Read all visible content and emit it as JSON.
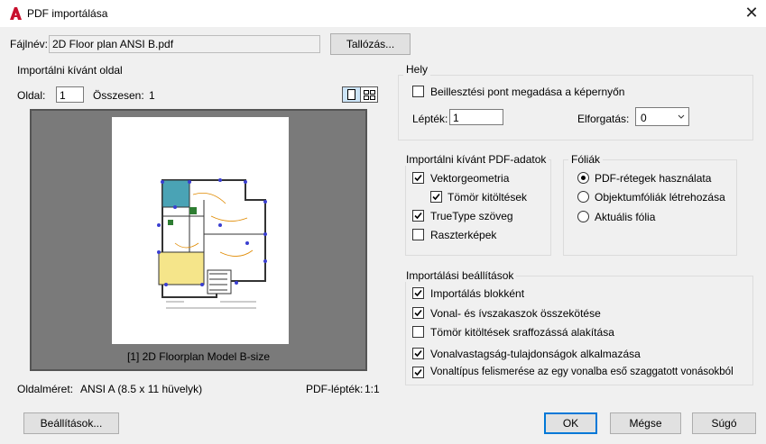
{
  "dialog": {
    "title": "PDF importálása",
    "close_glyph": "✕",
    "app_icon": "autocad-a-icon"
  },
  "file": {
    "label": "Fájlnév:",
    "value": "2D Floor plan ANSI B.pdf",
    "browse_label": "Tallózás..."
  },
  "page_group": {
    "title": "Importálni kívánt oldal",
    "page_label": "Oldal:",
    "page_value": "1",
    "total_label": "Összesen:",
    "total_value": "1",
    "preview_caption": "[1] 2D Floorplan Model B-size",
    "page_size_label": "Oldalméret:",
    "page_size_value": "ANSI A (8.5 x 11 hüvelyk)",
    "pdf_scale_label": "PDF-lépték:",
    "pdf_scale_value": "1:1"
  },
  "location": {
    "title": "Hely",
    "specify_onscreen": {
      "label": "Beillesztési pont megadása a képernyőn",
      "checked": false
    },
    "scale_label": "Lépték:",
    "scale_value": "1",
    "rotation_label": "Elforgatás:",
    "rotation_value": "0"
  },
  "pdf_data": {
    "title": "Importálni kívánt PDF-adatok",
    "vector": {
      "label": "Vektorgeometria",
      "checked": true
    },
    "solid_fills": {
      "label": "Tömör kitöltések",
      "checked": true
    },
    "truetype": {
      "label": "TrueType szöveg",
      "checked": true
    },
    "raster": {
      "label": "Raszterképek",
      "checked": false
    }
  },
  "layers": {
    "title": "Fóliák",
    "use_pdf_layers": {
      "label": "PDF-rétegek használata",
      "selected": true
    },
    "create_object_layers": {
      "label": "Objektumfóliák létrehozása",
      "selected": false
    },
    "current_layer": {
      "label": "Aktuális fólia",
      "selected": false
    }
  },
  "import_options": {
    "title": "Importálási beállítások",
    "as_block": {
      "label": "Importálás blokként",
      "checked": true
    },
    "join_segments": {
      "label": "Vonal- és ívszakaszok összekötése",
      "checked": true
    },
    "fills_to_hatch": {
      "label": "Tömör kitöltések sraffozássá alakítása",
      "checked": false
    },
    "lineweight": {
      "label": "Vonalvastagság-tulajdonságok alkalmazása",
      "checked": true
    },
    "infer_linetypes": {
      "label": "Vonaltípus felismerése az egy vonalba eső szaggatott vonásokból",
      "checked": true
    }
  },
  "footer": {
    "settings_label": "Beállítások...",
    "ok_label": "OK",
    "cancel_label": "Mégse",
    "help_label": "Súgó"
  },
  "colors": {
    "accent": "#0078d7",
    "app_icon": "#c8102e",
    "preview_bg": "#7a7a7a"
  }
}
